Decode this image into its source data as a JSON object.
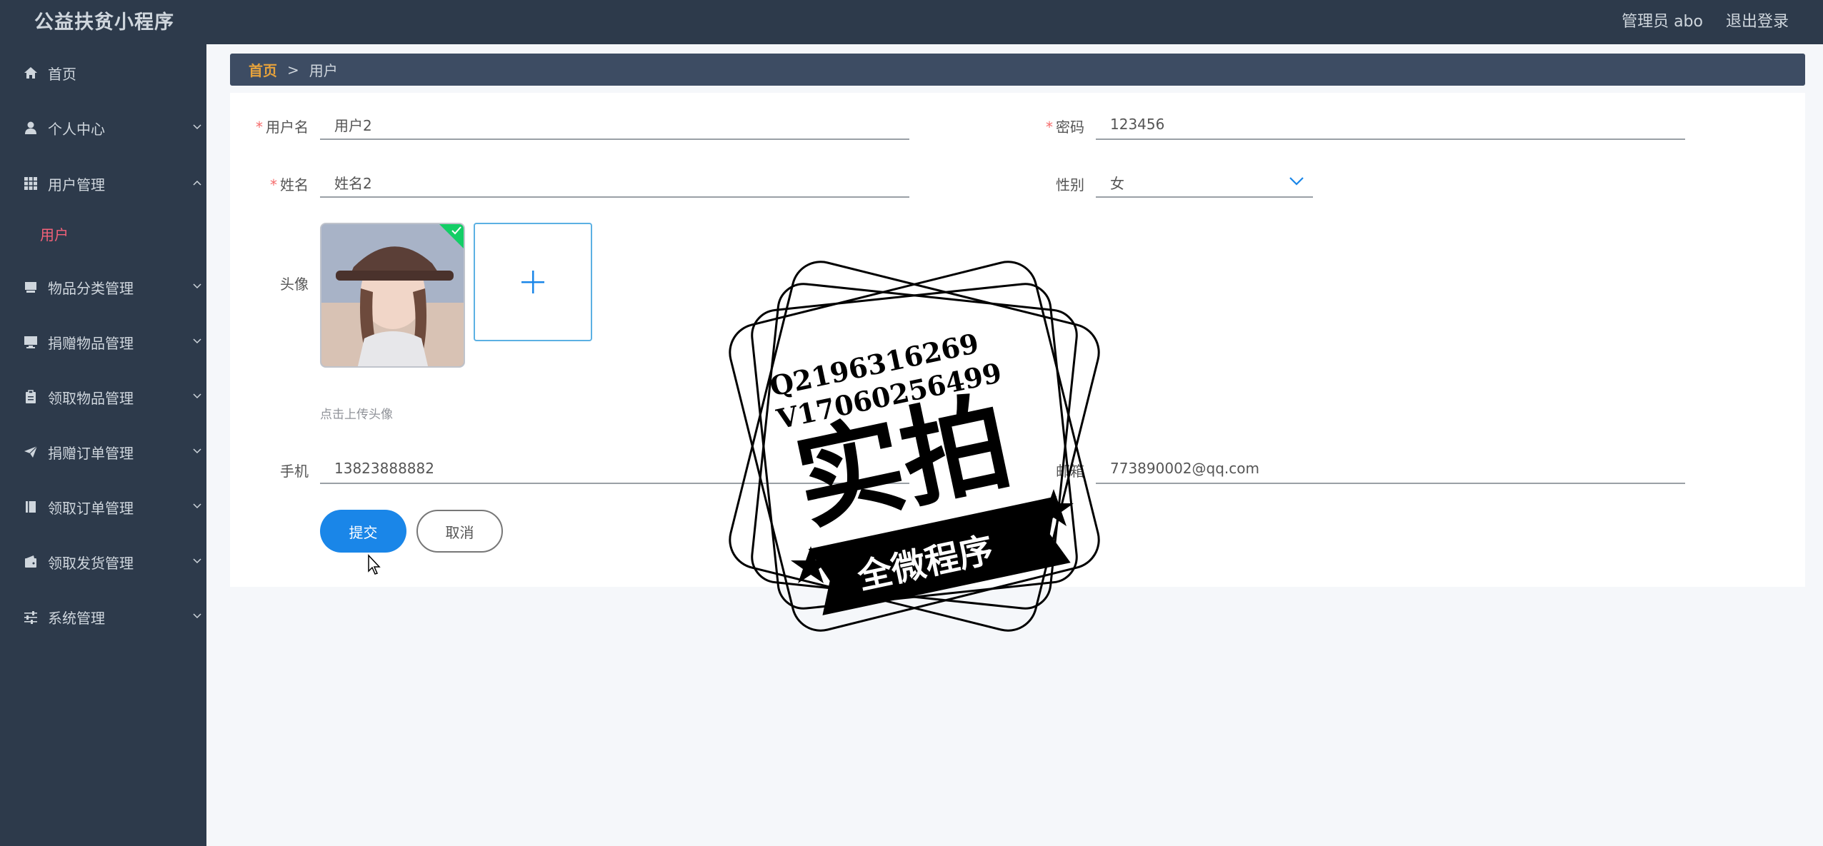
{
  "app": {
    "title": "公益扶贫小程序"
  },
  "header": {
    "admin": "管理员 abo",
    "logout": "退出登录"
  },
  "sidebar": {
    "items": [
      {
        "label": "首页",
        "icon": "home-icon"
      },
      {
        "label": "个人中心",
        "icon": "user-icon"
      },
      {
        "label": "用户管理",
        "icon": "grid-icon",
        "expanded": true,
        "children": [
          {
            "label": "用户",
            "active": true
          }
        ]
      },
      {
        "label": "物品分类管理",
        "icon": "box-icon"
      },
      {
        "label": "捐赠物品管理",
        "icon": "monitor-icon"
      },
      {
        "label": "领取物品管理",
        "icon": "clipboard-icon"
      },
      {
        "label": "捐赠订单管理",
        "icon": "send-icon"
      },
      {
        "label": "领取订单管理",
        "icon": "book-icon"
      },
      {
        "label": "领取发货管理",
        "icon": "wallet-icon"
      },
      {
        "label": "系统管理",
        "icon": "sliders-icon"
      }
    ]
  },
  "breadcrumb": {
    "home": "首页",
    "separator": ">",
    "current": "用户"
  },
  "form": {
    "username": {
      "label": "用户名",
      "value": "用户2"
    },
    "password": {
      "label": "密码",
      "value": "123456"
    },
    "name": {
      "label": "姓名",
      "value": "姓名2"
    },
    "gender": {
      "label": "性别",
      "value": "女"
    },
    "avatar": {
      "label": "头像",
      "hint": "点击上传头像"
    },
    "phone": {
      "label": "手机",
      "value": "13823888882"
    },
    "email": {
      "label": "邮箱",
      "value": "773890002@qq.com"
    },
    "submit": "提交",
    "cancel": "取消"
  },
  "watermark": {
    "line1": "Q2196316269",
    "line2": "V17060256499",
    "main": "实拍",
    "banner": "全微程序"
  },
  "colors": {
    "sidebar_bg": "#2d3a4b",
    "breadcrumb_bg": "#3d4c63",
    "accent_active": "#f5627a",
    "breadcrumb_home": "#e6a23c",
    "primary": "#1a86e8",
    "required": "#f56c6c"
  }
}
